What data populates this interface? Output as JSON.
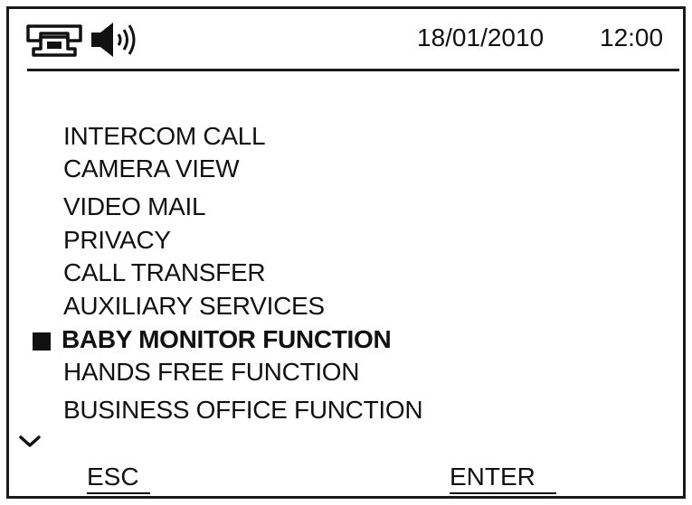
{
  "status_bar": {
    "icons": [
      "phone-icon",
      "speaker-icon"
    ],
    "date": "18/01/2010",
    "time": "12:00"
  },
  "menu": {
    "items": [
      {
        "label": "INTERCOM CALL"
      },
      {
        "label": "CAMERA VIEW"
      },
      {
        "label": "VIDEO MAIL"
      },
      {
        "label": "PRIVACY"
      },
      {
        "label": "CALL TRANSFER"
      },
      {
        "label": "AUXILIARY SERVICES"
      },
      {
        "label": "BABY MONITOR FUNCTION",
        "selected": true
      },
      {
        "label": "HANDS FREE FUNCTION"
      },
      {
        "label": "BUSINESS OFFICE FUNCTION"
      }
    ],
    "more_indicator_icon": "chevron-down-icon"
  },
  "softkeys": {
    "left": "ESC",
    "right": "ENTER"
  }
}
